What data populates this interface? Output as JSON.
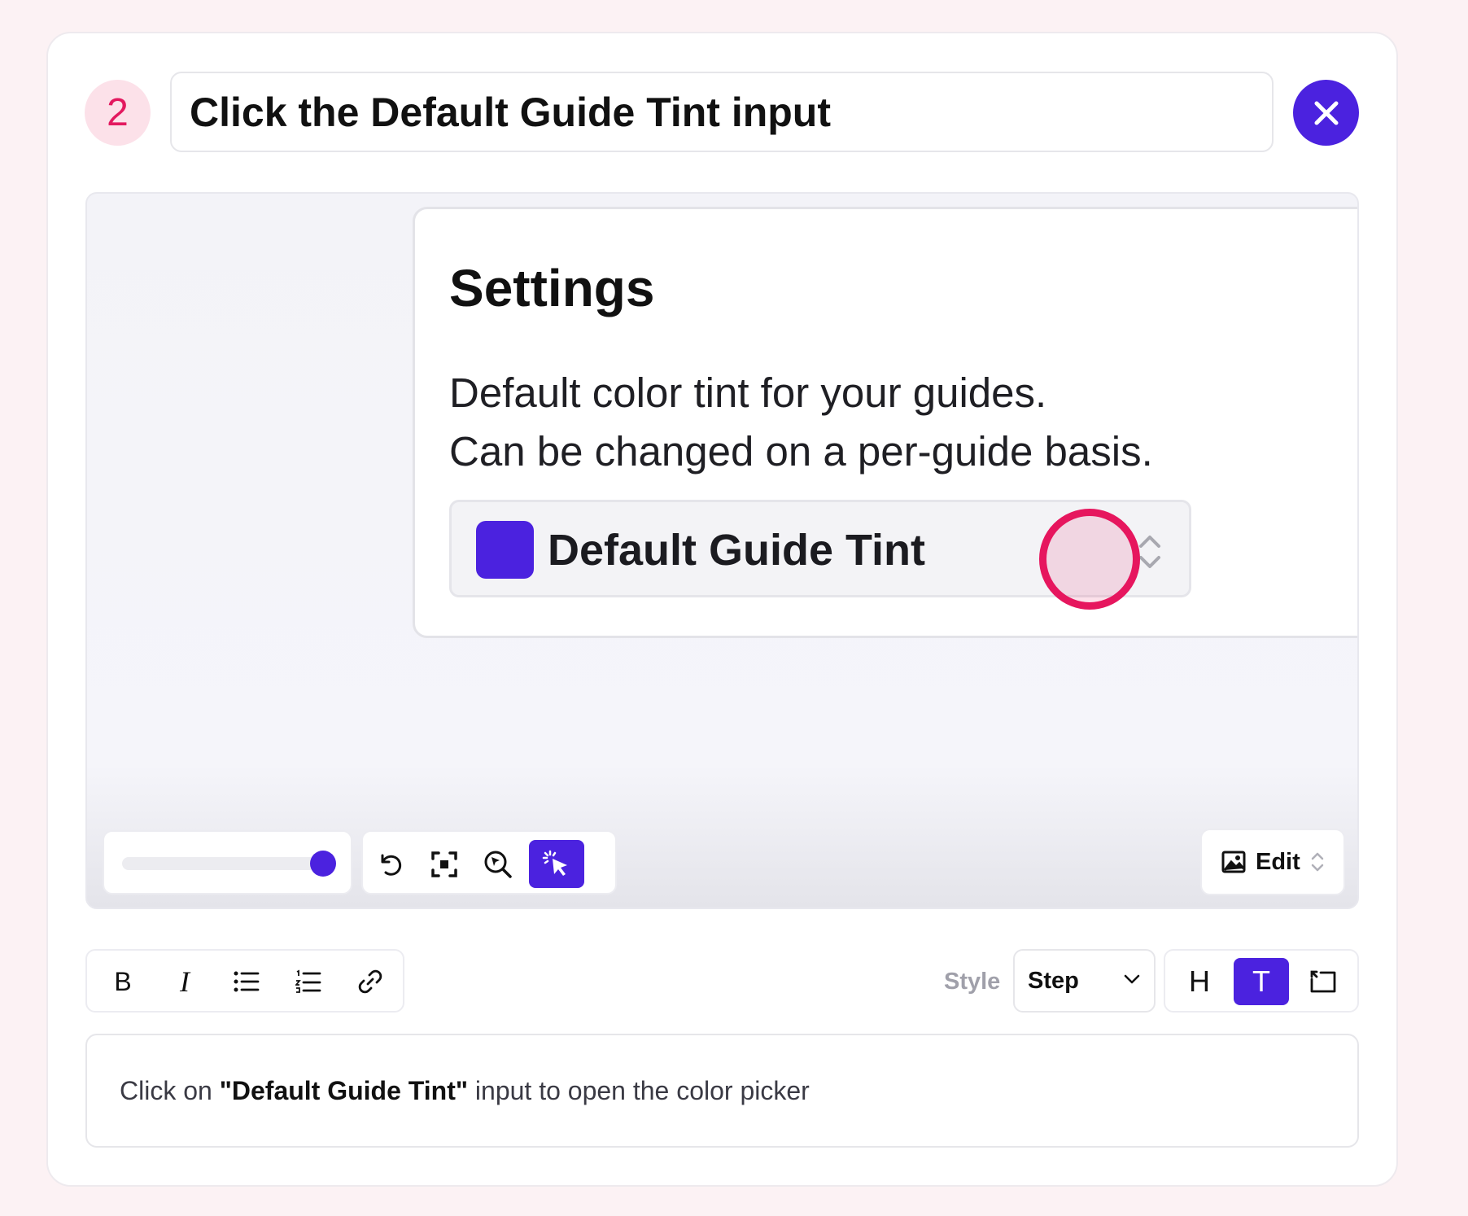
{
  "step": {
    "number": "2",
    "title": "Click the Default Guide Tint input"
  },
  "preview": {
    "settings_title": "Settings",
    "description_line1": "Default color tint for your guides.",
    "description_line2": "Can be changed on a per-guide basis.",
    "tint_select_label": "Default Guide Tint",
    "tint_color": "#4b22df",
    "zoom_level": 1.0,
    "toolbar_icons": [
      "undo-icon",
      "focus-icon",
      "zoom-cursor-icon",
      "click-cursor-icon"
    ],
    "edit_label": "Edit"
  },
  "editor": {
    "format_icons": [
      "bold-icon",
      "italic-icon",
      "bullet-list-icon",
      "numbered-list-icon",
      "link-icon"
    ],
    "bold_label": "B",
    "italic_label": "I",
    "style_label": "Style",
    "style_value": "Step",
    "heading_label": "H",
    "text_label": "T",
    "description_prefix": "Click on ",
    "description_bold": "\"Default Guide Tint\"",
    "description_suffix": " input to open the color picker"
  },
  "colors": {
    "accent": "#4b22df",
    "marker": "#e6165e"
  }
}
